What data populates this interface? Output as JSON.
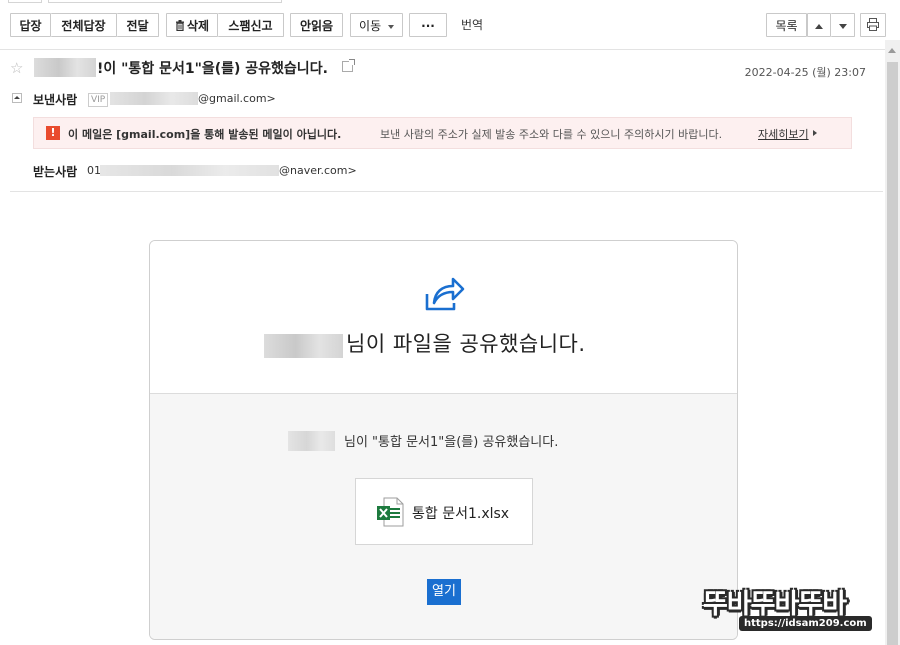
{
  "toolbar": {
    "reply": "답장",
    "reply_all": "전체답장",
    "forward": "전달",
    "delete": "삭제",
    "spam": "스팸신고",
    "unread": "안읽음",
    "move": "이동",
    "more": "···",
    "translate": "번역",
    "list": "목록",
    "print_icon": "print-icon"
  },
  "mail": {
    "subject": "!이 \"통합 문서1\"을(를) 공유했습니다.",
    "date": "2022-04-25 (월) 23:07",
    "sender_label": "보낸사람",
    "vip_badge": "VIP",
    "sender_suffix": "@gmail.com>",
    "recipient_label": "받는사람",
    "recipient_prefix": "01",
    "recipient_suffix": "@naver.com>"
  },
  "warning": {
    "icon_text": "!",
    "bold_text": "이 메일은 [gmail.com]을 통해 발송된 메일이 아닙니다.",
    "detail_text": "보낸 사람의 주소가 실제 발송 주소와 다를 수 있으니 주의하시기 바랍니다.",
    "more_link": "자세히보기"
  },
  "card": {
    "headline": "님이 파일을 공유했습니다.",
    "subline": "님이 \"통합 문서1\"을(를) 공유했습니다.",
    "file_name": "통합 문서1.xlsx",
    "open_button": "열기"
  },
  "watermark": {
    "brand": "뚜바뚜바뚜바",
    "url": "https://idsam209.com"
  },
  "colors": {
    "warning_bg": "#fdf0f0",
    "warning_icon": "#e94b2e",
    "accent_blue": "#1a6fd0",
    "excel_green": "#1d7a3e"
  }
}
